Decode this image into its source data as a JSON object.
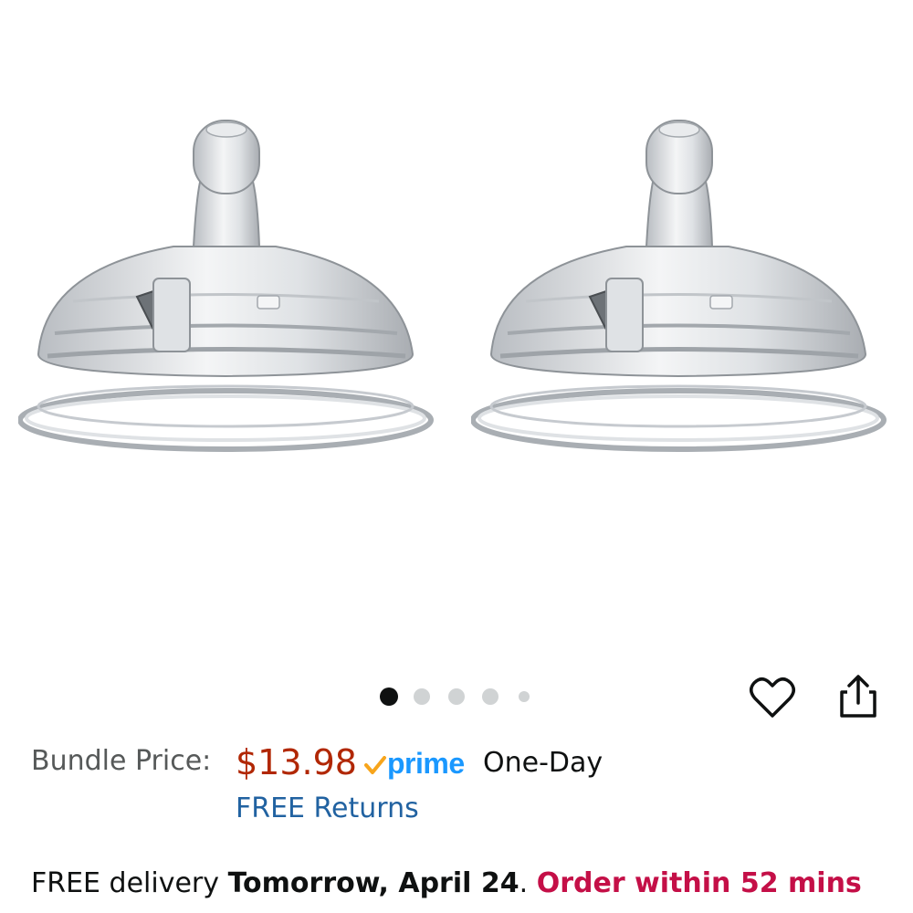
{
  "product": {
    "image_alt": "Silicone bottle nipples, 2 pack",
    "gallery_dots": [
      {
        "active": true
      },
      {
        "active": false
      },
      {
        "active": false
      },
      {
        "active": false
      },
      {
        "active": false
      }
    ],
    "wishlist_icon": "heart-icon",
    "share_icon": "share-icon"
  },
  "pricing": {
    "label": "Bundle Price:",
    "price": "$13.98",
    "prime_text": "prime",
    "prime_color": "#1a98ff",
    "prime_check_color": "#f7a51c",
    "shipping_speed": "One-Day",
    "returns": "FREE Returns",
    "price_color": "#b12704",
    "link_color": "#2162a1"
  },
  "delivery": {
    "prefix": "FREE delivery",
    "date": "Tomorrow, April 24",
    "separator": ".",
    "cutoff": "Order within 52 mins",
    "cutoff_color": "#c40f47"
  }
}
